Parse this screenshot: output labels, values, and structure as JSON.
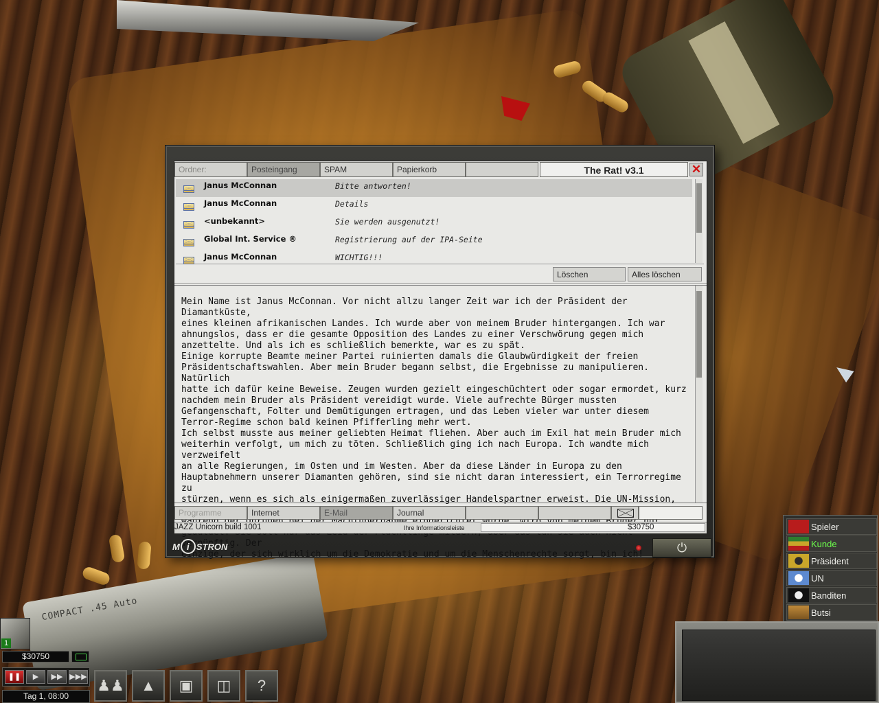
{
  "mail_client": {
    "folder_label": "Ordner:",
    "folders": [
      "Posteingang",
      "SPAM",
      "Papierkorb",
      ""
    ],
    "active_folder": "Posteingang",
    "title": "The Rat! v3.1",
    "close_glyph": "✕",
    "messages": [
      {
        "sender": "Janus McConnan",
        "subject": "Bitte antworten!",
        "selected": true
      },
      {
        "sender": "Janus McConnan",
        "subject": "Details",
        "selected": false
      },
      {
        "sender": "<unbekannt>",
        "subject": "Sie werden ausgenutzt!",
        "selected": false
      },
      {
        "sender": "Global Int. Service ®",
        "subject": "Registrierung auf der IPA-Seite",
        "selected": false
      },
      {
        "sender": "Janus McConnan",
        "subject": "WICHTIG!!!",
        "selected": false
      }
    ],
    "delete_label": "Löschen",
    "delete_all_label": "Alles löschen",
    "body": "Mein Name ist Janus McConnan. Vor nicht allzu langer Zeit war ich der Präsident der Diamantküste,\neines kleinen afrikanischen Landes. Ich wurde aber von meinem Bruder hintergangen. Ich war\nahnungslos, dass er die gesamte Opposition des Landes zu einer Verschwörung gegen mich\nanzettelte. Und als ich es schließlich bemerkte, war es zu spät.\nEinige korrupte Beamte meiner Partei ruinierten damals die Glaubwürdigkeit der freien\nPräsidentschaftswahlen. Aber mein Bruder begann selbst, die Ergebnisse zu manipulieren. Natürlich\nhatte ich dafür keine Beweise. Zeugen wurden gezielt eingeschüchtert oder sogar ermordet, kurz\nnachdem mein Bruder als Präsident vereidigt wurde. Viele aufrechte Bürger mussten\nGefangenschaft, Folter und Demütigungen ertragen, und das Leben vieler war unter diesem\nTerror-Regime schon bald keinen Pfifferling mehr wert.\nIch selbst musste aus meiner geliebten Heimat fliehen. Aber auch im Exil hat mein Bruder mich\nweiterhin verfolgt, um mich zu töten. Schließlich ging ich nach Europa. Ich wandte mich verzweifelt\nan alle Regierungen, im Osten und im Westen. Aber da diese Länder in Europa zu den\nHauptabnehmern unserer Diamanten gehören, sind sie nicht daran interessiert, ein Terrorregime zu\nstürzen, wenn es sich als einigermaßen zuverlässiger Handelspartner erweist. Die UN-Mission, die\nwährend der Unruhen bei der Machtübernahme eingerichtet wurde, wird von meinem Bruder nur\ngeduldet. Sie soll nur das Leid der Flüchtlinge mildern, aber das tun sie auch nicht vernünftig. Der\neinzige, der sich wirklich um die Demokratie und um die Menschenrechte sorgt, bin ich!",
    "bottom_tabs": [
      "Programme",
      "Internet",
      "E-Mail",
      "Journal",
      "",
      ""
    ],
    "active_bottom_tab": "E-Mail",
    "build": "JAZZ Unicorn build 1001",
    "info_label": "Ihre Informationsleiste",
    "balance": "$30750",
    "logo_parts": {
      "m": "M",
      "i": "i",
      "rest": "STRON"
    },
    "power_glyph": "⏻"
  },
  "factions": [
    {
      "name": "Spieler",
      "color": "#b81c1c",
      "highlight": false
    },
    {
      "name": "Kunde",
      "color": "#2e7d2e",
      "highlight": true
    },
    {
      "name": "Präsident",
      "color": "#c9a62a",
      "highlight": false
    },
    {
      "name": "UN",
      "color": "#5d8ad0",
      "highlight": false
    },
    {
      "name": "Banditen",
      "color": "#111111",
      "highlight": false
    },
    {
      "name": "Butsi",
      "color": "#c08a3a",
      "highlight": false
    }
  ],
  "hud": {
    "money": "$30750",
    "unit_count": "1",
    "time": "Tag 1, 08:00",
    "controls": [
      "❚❚",
      "▶",
      "▶▶",
      "▶▶▶"
    ],
    "tools": [
      "soldiers",
      "helmet",
      "laptop",
      "computer",
      "?"
    ]
  },
  "background": {
    "pistol_text": "COMPACT .45 Auto"
  },
  "colors": {
    "accent_red": "#d01010",
    "panel": "#e9e9e6",
    "frame": "#3c3c38",
    "ok_green": "#6cff4c"
  }
}
